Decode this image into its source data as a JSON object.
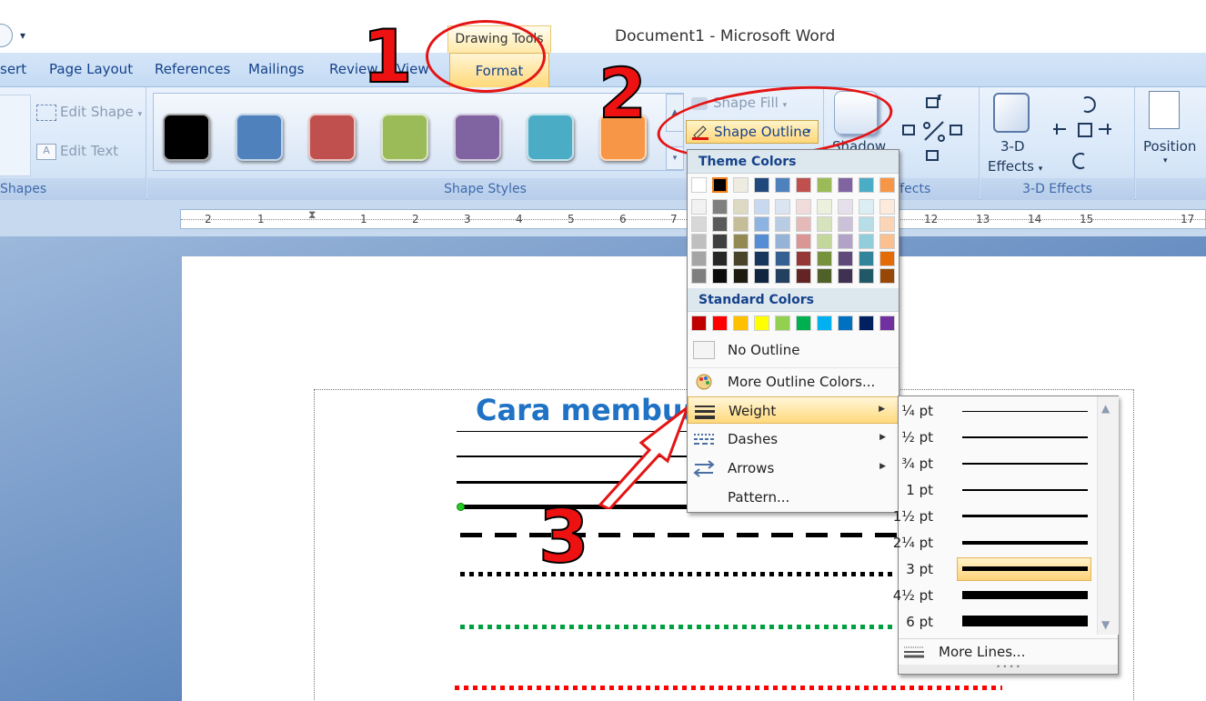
{
  "titlebar": {
    "context_tab_title": "Drawing Tools",
    "window_title": "Document1 - Microsoft Word"
  },
  "tabs": {
    "insert": "sert",
    "page_layout": "Page Layout",
    "references": "References",
    "mailings": "Mailings",
    "review": "Review",
    "view": "View",
    "format": "Format"
  },
  "ribbon": {
    "insert_shapes": {
      "edit_shape": "Edit Shape",
      "edit_text": "Edit Text",
      "group_label": "Shapes"
    },
    "shape_styles": {
      "group_label": "Shape Styles",
      "swatches": [
        "#000000",
        "#4f81bd",
        "#c0504d",
        "#9bbb59",
        "#8064a2",
        "#4bacc6",
        "#f79646"
      ],
      "shape_fill": "Shape Fill",
      "shape_outline": "Shape Outline"
    },
    "shadow_effects": {
      "button_label": "Shadow",
      "group_label": "w Effects"
    },
    "three_d": {
      "button_label": "3-D",
      "button_label2": "Effects",
      "group_label": "3-D Effects"
    },
    "arrange": {
      "position_label": "Position"
    }
  },
  "ruler": {
    "labels": [
      "2",
      "1",
      "1",
      "1",
      "2",
      "3",
      "4",
      "5",
      "6",
      "7",
      "12",
      "13",
      "14",
      "15",
      "17"
    ]
  },
  "document": {
    "heading": "Cara membuat"
  },
  "annotations": {
    "n1": "1",
    "n2": "2",
    "n3": "3"
  },
  "outline_menu": {
    "theme_colors_label": "Theme Colors",
    "theme_top_row": [
      "#ffffff",
      "#000000",
      "#eeece1",
      "#1f497d",
      "#4f81bd",
      "#c0504d",
      "#9bbb59",
      "#8064a2",
      "#4bacc6",
      "#f79646"
    ],
    "theme_shades": [
      [
        "#f2f2f2",
        "#7f7f7f",
        "#ddd9c3",
        "#c6d9f0",
        "#dbe5f1",
        "#f2dcdb",
        "#ebf1dd",
        "#e5e0ec",
        "#dbeef3",
        "#fdeada"
      ],
      [
        "#d8d8d8",
        "#595959",
        "#c4bd97",
        "#8db3e2",
        "#b8cce4",
        "#e5b9b7",
        "#d7e3bc",
        "#ccc1d9",
        "#b7dde8",
        "#fbd5b5"
      ],
      [
        "#bfbfbf",
        "#3f3f3f",
        "#938953",
        "#548dd4",
        "#95b3d7",
        "#d99694",
        "#c3d69b",
        "#b2a2c7",
        "#92cddc",
        "#fac08f"
      ],
      [
        "#a5a5a5",
        "#262626",
        "#494429",
        "#17365d",
        "#366092",
        "#953734",
        "#76923c",
        "#5f497a",
        "#31859b",
        "#e36c09"
      ],
      [
        "#7f7f7f",
        "#0c0c0c",
        "#1d1b10",
        "#0f243e",
        "#244061",
        "#632423",
        "#4f6128",
        "#3f3151",
        "#205867",
        "#974806"
      ]
    ],
    "standard_colors_label": "Standard Colors",
    "standard_colors": [
      "#c00000",
      "#ff0000",
      "#ffc000",
      "#ffff00",
      "#92d050",
      "#00b050",
      "#00b0f0",
      "#0070c0",
      "#002060",
      "#7030a0"
    ],
    "no_outline": "No Outline",
    "more_outline_colors": "More Outline Colors...",
    "weight": "Weight",
    "dashes": "Dashes",
    "arrows": "Arrows",
    "pattern": "Pattern..."
  },
  "weight_menu": {
    "options": [
      "¼ pt",
      "½ pt",
      "¾ pt",
      "1 pt",
      "1½ pt",
      "2¼ pt",
      "3 pt",
      "4½ pt",
      "6 pt"
    ],
    "selected": "3 pt",
    "more_lines": "More Lines..."
  }
}
